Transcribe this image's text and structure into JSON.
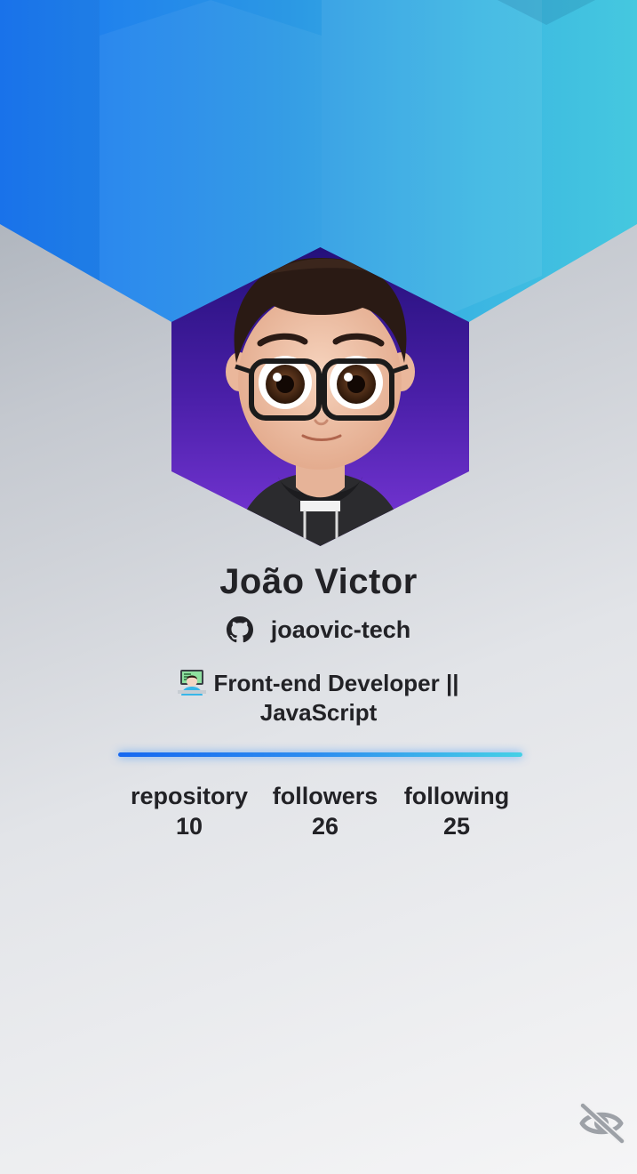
{
  "profile": {
    "name": "João Victor",
    "handle": "joaovic-tech",
    "bio": "Front-end Developer || JavaScript"
  },
  "stats": [
    {
      "label": "repository",
      "value": "10"
    },
    {
      "label": "followers",
      "value": "26"
    },
    {
      "label": "following",
      "value": "25"
    }
  ],
  "icons": {
    "github": "github-icon",
    "developer_emoji": "technologist-emoji",
    "visibility": "eye-off-icon"
  },
  "colors": {
    "header_start": "#1a76f2",
    "header_end": "#45c8df",
    "avatar_bg_top": "#24107a",
    "avatar_bg_bottom": "#7a38d9",
    "divider_start": "#1668f0",
    "divider_end": "#46d0e6",
    "text": "#222226"
  }
}
